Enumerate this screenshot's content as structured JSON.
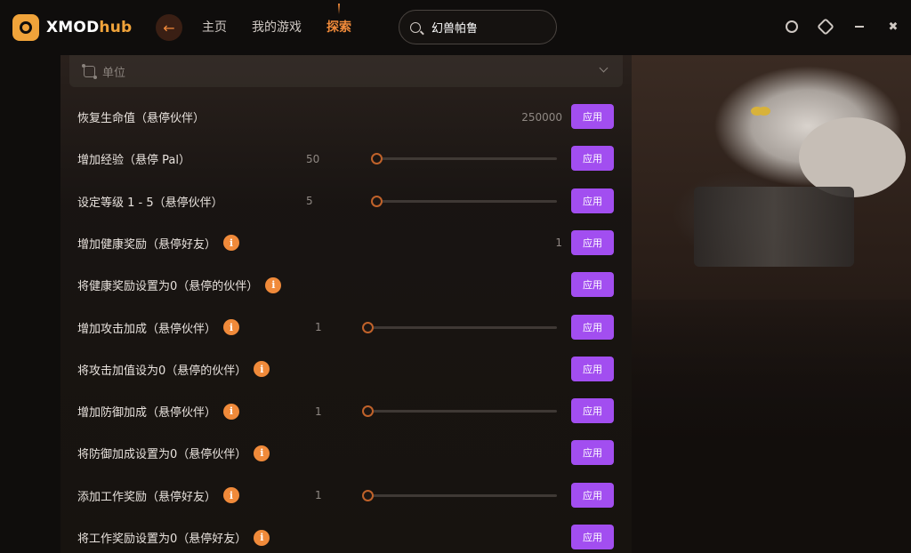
{
  "app": {
    "logo_main": "XMOD",
    "logo_accent": "hub"
  },
  "nav": {
    "items": [
      {
        "label": "主页"
      },
      {
        "label": "我的游戏"
      },
      {
        "label": "探索"
      }
    ],
    "active_index": 2
  },
  "search": {
    "value": "幻兽帕鲁"
  },
  "section": {
    "title": "单位"
  },
  "rows": [
    {
      "label": "恢复生命值（悬停伙伴）",
      "value": "250000",
      "button": "应用"
    },
    {
      "label": "增加经验（悬停 Pal）",
      "value": "50",
      "slider": 0.0,
      "button": "应用"
    },
    {
      "label": "设定等级 1 - 5（悬停伙伴）",
      "value": "5",
      "slider": 0.0,
      "button": "应用"
    },
    {
      "label": "增加健康奖励（悬停好友）",
      "info": true,
      "value": "1",
      "button": "应用"
    },
    {
      "label": "将健康奖励设置为0（悬停的伙伴）",
      "info": true,
      "button": "应用"
    },
    {
      "label": "增加攻击加成（悬停伙伴）",
      "info": true,
      "value": "1",
      "slider": 0.0,
      "button": "应用"
    },
    {
      "label": "将攻击加值设为0（悬停的伙伴）",
      "info": true,
      "button": "应用"
    },
    {
      "label": "增加防御加成（悬停伙伴）",
      "info": true,
      "value": "1",
      "slider": 0.0,
      "button": "应用"
    },
    {
      "label": "将防御加成设置为0（悬停伙伴）",
      "info": true,
      "button": "应用"
    },
    {
      "label": "添加工作奖励（悬停好友）",
      "info": true,
      "value": "1",
      "slider": 0.0,
      "button": "应用"
    },
    {
      "label": "将工作奖励设置为0（悬停好友）",
      "info": true,
      "button": "应用"
    }
  ],
  "info_glyph": "i",
  "colors": {
    "accent": "#f08a3a",
    "apply_button": "#a24ef0",
    "background": "#0f0d0c"
  },
  "icons": {
    "back": "arrow-left-icon",
    "search": "search-icon",
    "account": "avatar-icon",
    "settings": "gear-icon",
    "minimize": "minimize-icon",
    "fullscreen": "fullscreen-icon",
    "section": "unit-icon",
    "collapse": "chevron-down-icon",
    "info": "info-icon"
  }
}
